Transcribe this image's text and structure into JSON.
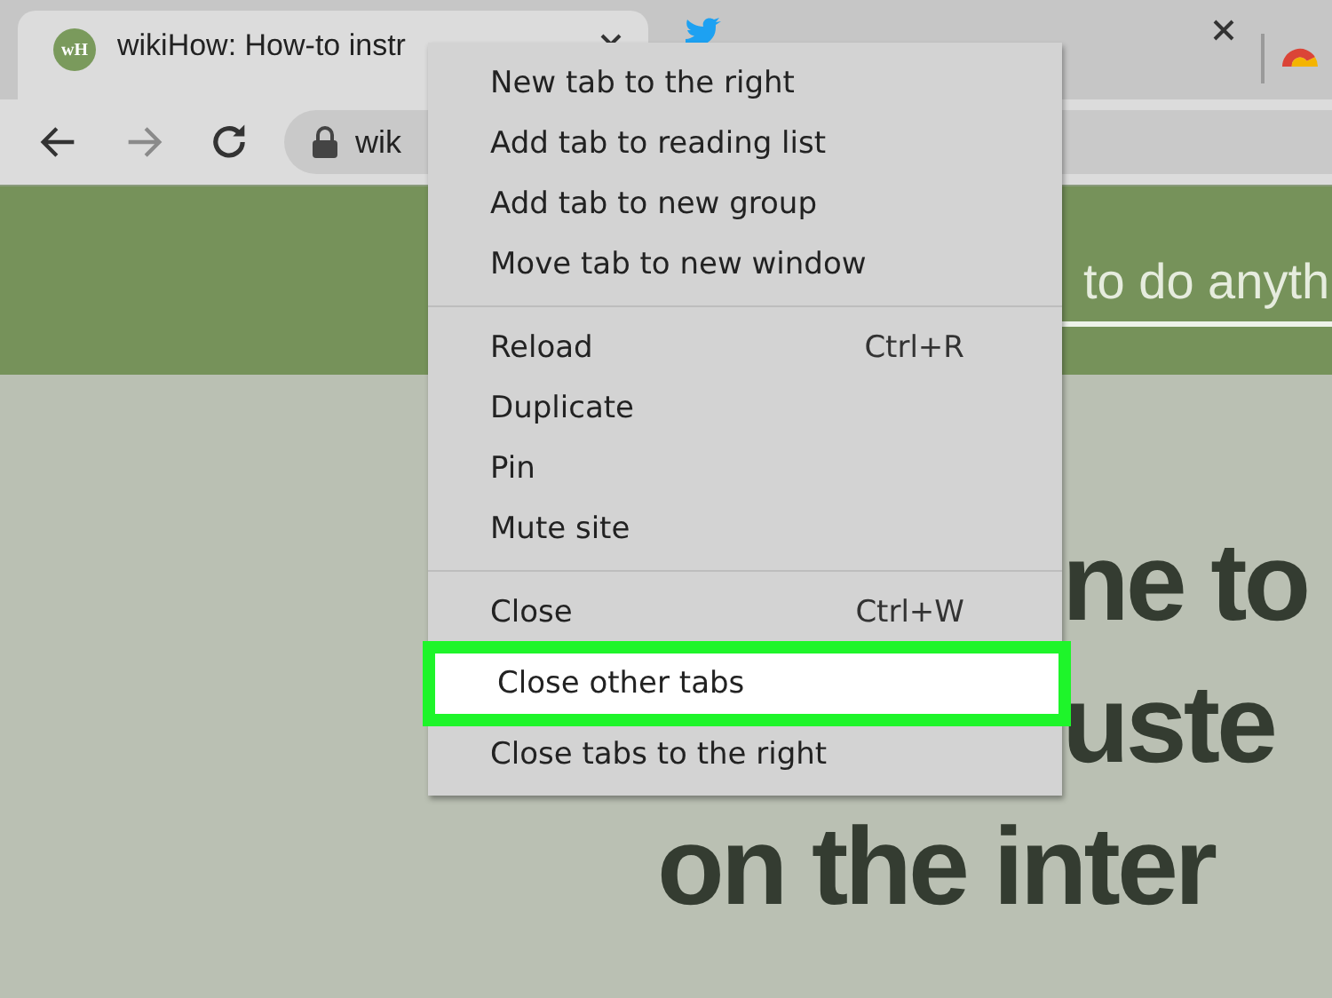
{
  "tabs": [
    {
      "kind": "site",
      "favicon_text": "wH",
      "title": "wikiHow: How-to instr",
      "selected": true
    },
    {
      "kind": "bird",
      "selected": false
    },
    {
      "kind": "logo",
      "selected": false
    }
  ],
  "toolbar": {
    "buttons": [
      {
        "kind": "back",
        "disabled": false
      },
      {
        "kind": "forward",
        "disabled": true
      },
      {
        "kind": "reload",
        "disabled": false
      }
    ],
    "address": "wik"
  },
  "page": {
    "search_text": "to do anyth",
    "headline": [
      "ne to",
      "uste",
      "on the inter"
    ]
  },
  "menu": {
    "groups": [
      [
        {
          "label": "New tab to the right",
          "selected": false
        },
        {
          "label": "Add tab to reading list",
          "selected": false
        },
        {
          "label": "Add tab to new group",
          "selected": false
        },
        {
          "label": "Move tab to new window",
          "selected": false
        }
      ],
      [
        {
          "label": "Reload",
          "shortcut": "Ctrl+R",
          "selected": false
        },
        {
          "label": "Duplicate",
          "selected": false
        },
        {
          "label": "Pin",
          "selected": false
        },
        {
          "label": "Mute site",
          "selected": false
        }
      ],
      [
        {
          "label": "Close",
          "shortcut": "Ctrl+W",
          "selected": false
        },
        {
          "label": "Close other tabs",
          "selected": true
        },
        {
          "label": "Close tabs to the right",
          "selected": false
        }
      ]
    ]
  }
}
